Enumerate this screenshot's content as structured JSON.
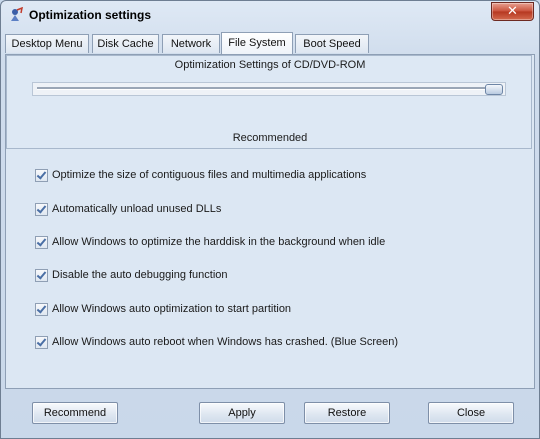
{
  "window": {
    "title": "Optimization settings",
    "close_label": "✕",
    "icon": "app-icon"
  },
  "tabs": [
    {
      "label": "Desktop Menu",
      "active": false
    },
    {
      "label": "Disk Cache",
      "active": false
    },
    {
      "label": "Network",
      "active": false
    },
    {
      "label": "File System",
      "active": true
    },
    {
      "label": "Boot Speed",
      "active": false
    }
  ],
  "group": {
    "title": "Optimization Settings of CD/DVD-ROM",
    "level_label": "Recommended",
    "slider_level": 1.0
  },
  "options": [
    {
      "label": "Optimize the size of contiguous files and multimedia applications",
      "checked": true
    },
    {
      "label": "Automatically unload unused DLLs",
      "checked": true
    },
    {
      "label": "Allow Windows to optimize the harddisk in the background when idle",
      "checked": true
    },
    {
      "label": "Disable the auto debugging function",
      "checked": true
    },
    {
      "label": "Allow Windows auto optimization to start partition",
      "checked": true
    },
    {
      "label": "Allow Windows auto reboot when Windows has crashed. (Blue Screen)",
      "checked": true
    }
  ],
  "buttons": {
    "recommend": "Recommend",
    "apply": "Apply",
    "restore": "Restore",
    "close": "Close"
  },
  "colors": {
    "window_bg": "#dce7f3",
    "close_button": "#c9503a",
    "checkmark": "#4a6fa5"
  }
}
